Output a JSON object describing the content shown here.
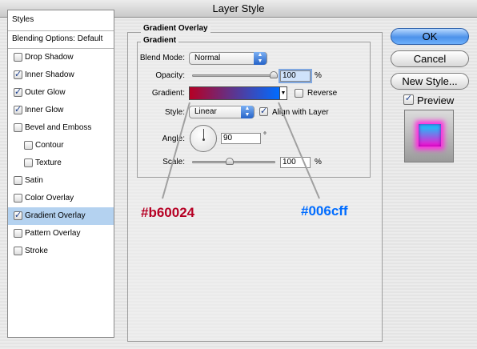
{
  "window": {
    "title": "Layer Style"
  },
  "sidebar": {
    "header": "Styles",
    "blending": "Blending Options: Default",
    "items": [
      {
        "label": "Drop Shadow",
        "checked": false,
        "indent": false
      },
      {
        "label": "Inner Shadow",
        "checked": true,
        "indent": false
      },
      {
        "label": "Outer Glow",
        "checked": true,
        "indent": false
      },
      {
        "label": "Inner Glow",
        "checked": true,
        "indent": false
      },
      {
        "label": "Bevel and Emboss",
        "checked": false,
        "indent": false
      },
      {
        "label": "Contour",
        "checked": false,
        "indent": true
      },
      {
        "label": "Texture",
        "checked": false,
        "indent": true
      },
      {
        "label": "Satin",
        "checked": false,
        "indent": false
      },
      {
        "label": "Color Overlay",
        "checked": false,
        "indent": false
      },
      {
        "label": "Gradient Overlay",
        "checked": true,
        "indent": false,
        "selected": true
      },
      {
        "label": "Pattern Overlay",
        "checked": false,
        "indent": false
      },
      {
        "label": "Stroke",
        "checked": false,
        "indent": false
      }
    ]
  },
  "panel": {
    "group_title": "Gradient Overlay",
    "subgroup_title": "Gradient",
    "blend_mode_label": "Blend Mode:",
    "blend_mode_value": "Normal",
    "opacity_label": "Opacity:",
    "opacity_value": "100",
    "percent": "%",
    "gradient_label": "Gradient:",
    "reverse_label": "Reverse",
    "reverse_checked": false,
    "style_label": "Style:",
    "style_value": "Linear",
    "align_label": "Align with Layer",
    "align_checked": true,
    "angle_label": "Angle:",
    "angle_value": "90",
    "degree": "°",
    "scale_label": "Scale:",
    "scale_value": "100",
    "opacity_level": 1.0,
    "scale_level": 0.45
  },
  "buttons": {
    "ok": "OK",
    "cancel": "Cancel",
    "new_style": "New Style...",
    "preview_label": "Preview",
    "preview_checked": true
  },
  "annotations": {
    "left_color_text": "#b60024",
    "right_color_text": "#006cff"
  },
  "colors": {
    "gradient_start": "#b60024",
    "gradient_end": "#006cff",
    "selected_row": "#b4d2f0",
    "default_button": "#4d92ea"
  }
}
